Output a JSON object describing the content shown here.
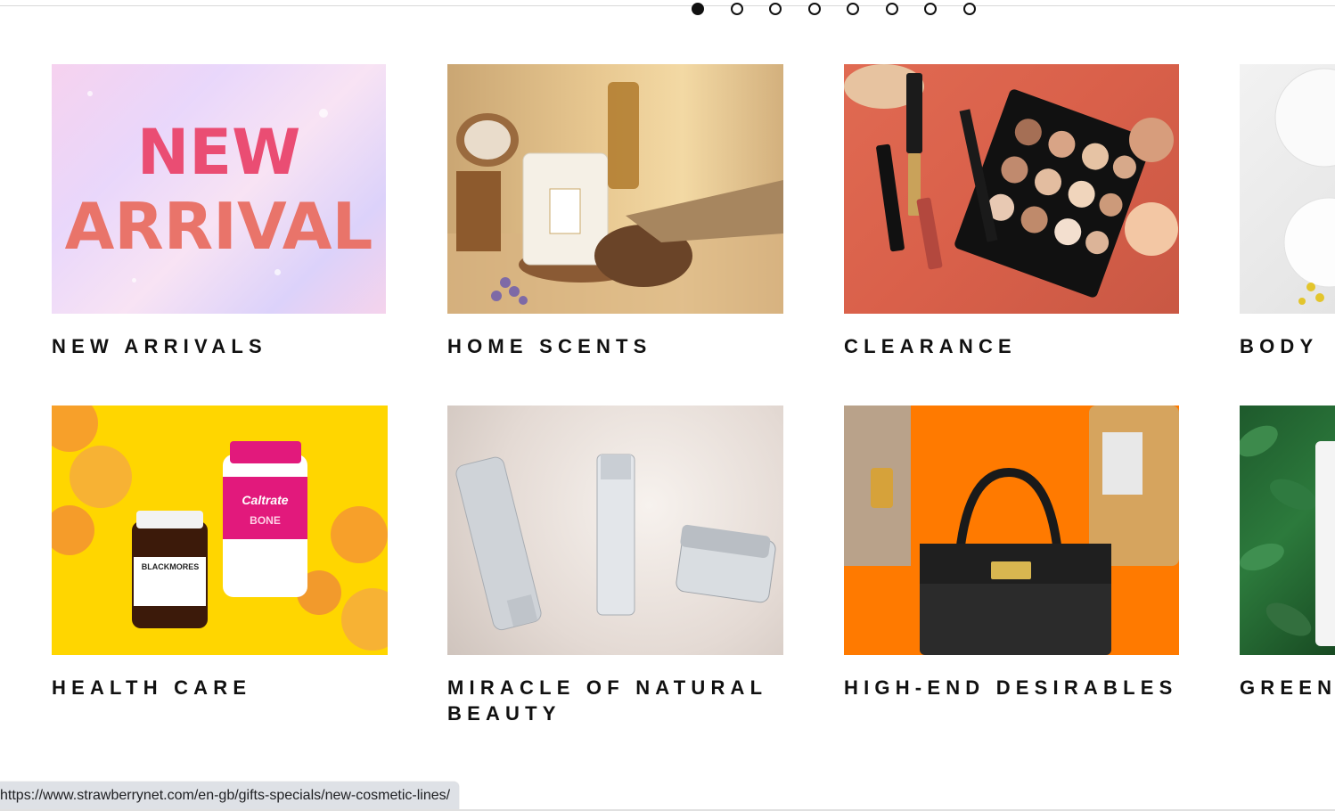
{
  "carousel": {
    "dot_count": 8,
    "active_index": 0
  },
  "tiles": [
    {
      "label": "NEW ARRIVALS",
      "image_text": [
        "NEW",
        "ARRIVAL"
      ]
    },
    {
      "label": "HOME SCENTS"
    },
    {
      "label": "CLEARANCE"
    },
    {
      "label": "BODY"
    },
    {
      "label": "HEALTH CARE",
      "image_text": [
        "BLACKMORES",
        "Caltrate",
        "BONE"
      ]
    },
    {
      "label": "MIRACLE OF NATURAL BEAUTY"
    },
    {
      "label": "HIGH-END DESIRABLES"
    },
    {
      "label": "GREEN"
    }
  ],
  "status_bar": {
    "url": "https://www.strawberrynet.com/en-gb/gifts-specials/new-cosmetic-lines/"
  },
  "colors": {
    "accent_pink": "#e54a74",
    "orange": "#ff7a00",
    "yellow": "#ffd600",
    "label_text": "#111111"
  }
}
